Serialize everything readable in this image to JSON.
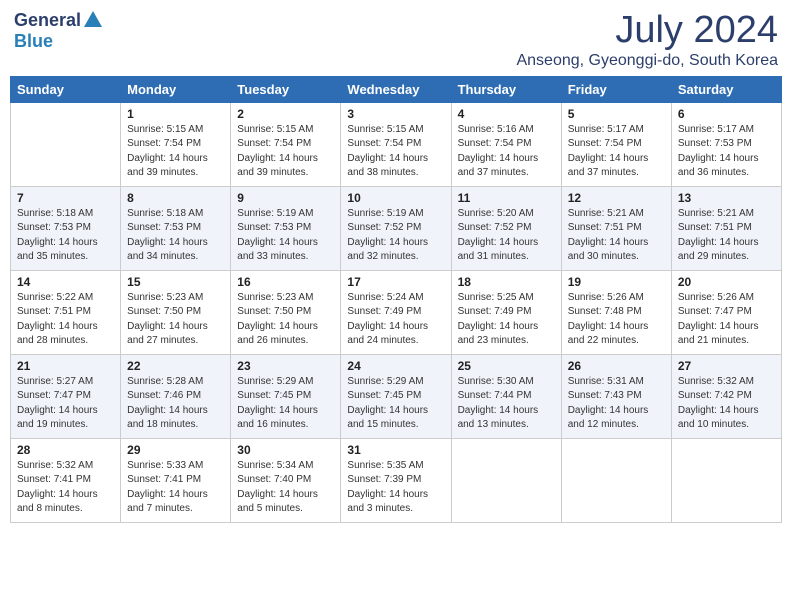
{
  "header": {
    "logo_general": "General",
    "logo_blue": "Blue",
    "month_title": "July 2024",
    "location": "Anseong, Gyeonggi-do, South Korea"
  },
  "days_of_week": [
    "Sunday",
    "Monday",
    "Tuesday",
    "Wednesday",
    "Thursday",
    "Friday",
    "Saturday"
  ],
  "weeks": [
    [
      {
        "day": "",
        "info": ""
      },
      {
        "day": "1",
        "info": "Sunrise: 5:15 AM\nSunset: 7:54 PM\nDaylight: 14 hours\nand 39 minutes."
      },
      {
        "day": "2",
        "info": "Sunrise: 5:15 AM\nSunset: 7:54 PM\nDaylight: 14 hours\nand 39 minutes."
      },
      {
        "day": "3",
        "info": "Sunrise: 5:15 AM\nSunset: 7:54 PM\nDaylight: 14 hours\nand 38 minutes."
      },
      {
        "day": "4",
        "info": "Sunrise: 5:16 AM\nSunset: 7:54 PM\nDaylight: 14 hours\nand 37 minutes."
      },
      {
        "day": "5",
        "info": "Sunrise: 5:17 AM\nSunset: 7:54 PM\nDaylight: 14 hours\nand 37 minutes."
      },
      {
        "day": "6",
        "info": "Sunrise: 5:17 AM\nSunset: 7:53 PM\nDaylight: 14 hours\nand 36 minutes."
      }
    ],
    [
      {
        "day": "7",
        "info": "Sunrise: 5:18 AM\nSunset: 7:53 PM\nDaylight: 14 hours\nand 35 minutes."
      },
      {
        "day": "8",
        "info": "Sunrise: 5:18 AM\nSunset: 7:53 PM\nDaylight: 14 hours\nand 34 minutes."
      },
      {
        "day": "9",
        "info": "Sunrise: 5:19 AM\nSunset: 7:53 PM\nDaylight: 14 hours\nand 33 minutes."
      },
      {
        "day": "10",
        "info": "Sunrise: 5:19 AM\nSunset: 7:52 PM\nDaylight: 14 hours\nand 32 minutes."
      },
      {
        "day": "11",
        "info": "Sunrise: 5:20 AM\nSunset: 7:52 PM\nDaylight: 14 hours\nand 31 minutes."
      },
      {
        "day": "12",
        "info": "Sunrise: 5:21 AM\nSunset: 7:51 PM\nDaylight: 14 hours\nand 30 minutes."
      },
      {
        "day": "13",
        "info": "Sunrise: 5:21 AM\nSunset: 7:51 PM\nDaylight: 14 hours\nand 29 minutes."
      }
    ],
    [
      {
        "day": "14",
        "info": "Sunrise: 5:22 AM\nSunset: 7:51 PM\nDaylight: 14 hours\nand 28 minutes."
      },
      {
        "day": "15",
        "info": "Sunrise: 5:23 AM\nSunset: 7:50 PM\nDaylight: 14 hours\nand 27 minutes."
      },
      {
        "day": "16",
        "info": "Sunrise: 5:23 AM\nSunset: 7:50 PM\nDaylight: 14 hours\nand 26 minutes."
      },
      {
        "day": "17",
        "info": "Sunrise: 5:24 AM\nSunset: 7:49 PM\nDaylight: 14 hours\nand 24 minutes."
      },
      {
        "day": "18",
        "info": "Sunrise: 5:25 AM\nSunset: 7:49 PM\nDaylight: 14 hours\nand 23 minutes."
      },
      {
        "day": "19",
        "info": "Sunrise: 5:26 AM\nSunset: 7:48 PM\nDaylight: 14 hours\nand 22 minutes."
      },
      {
        "day": "20",
        "info": "Sunrise: 5:26 AM\nSunset: 7:47 PM\nDaylight: 14 hours\nand 21 minutes."
      }
    ],
    [
      {
        "day": "21",
        "info": "Sunrise: 5:27 AM\nSunset: 7:47 PM\nDaylight: 14 hours\nand 19 minutes."
      },
      {
        "day": "22",
        "info": "Sunrise: 5:28 AM\nSunset: 7:46 PM\nDaylight: 14 hours\nand 18 minutes."
      },
      {
        "day": "23",
        "info": "Sunrise: 5:29 AM\nSunset: 7:45 PM\nDaylight: 14 hours\nand 16 minutes."
      },
      {
        "day": "24",
        "info": "Sunrise: 5:29 AM\nSunset: 7:45 PM\nDaylight: 14 hours\nand 15 minutes."
      },
      {
        "day": "25",
        "info": "Sunrise: 5:30 AM\nSunset: 7:44 PM\nDaylight: 14 hours\nand 13 minutes."
      },
      {
        "day": "26",
        "info": "Sunrise: 5:31 AM\nSunset: 7:43 PM\nDaylight: 14 hours\nand 12 minutes."
      },
      {
        "day": "27",
        "info": "Sunrise: 5:32 AM\nSunset: 7:42 PM\nDaylight: 14 hours\nand 10 minutes."
      }
    ],
    [
      {
        "day": "28",
        "info": "Sunrise: 5:32 AM\nSunset: 7:41 PM\nDaylight: 14 hours\nand 8 minutes."
      },
      {
        "day": "29",
        "info": "Sunrise: 5:33 AM\nSunset: 7:41 PM\nDaylight: 14 hours\nand 7 minutes."
      },
      {
        "day": "30",
        "info": "Sunrise: 5:34 AM\nSunset: 7:40 PM\nDaylight: 14 hours\nand 5 minutes."
      },
      {
        "day": "31",
        "info": "Sunrise: 5:35 AM\nSunset: 7:39 PM\nDaylight: 14 hours\nand 3 minutes."
      },
      {
        "day": "",
        "info": ""
      },
      {
        "day": "",
        "info": ""
      },
      {
        "day": "",
        "info": ""
      }
    ]
  ]
}
